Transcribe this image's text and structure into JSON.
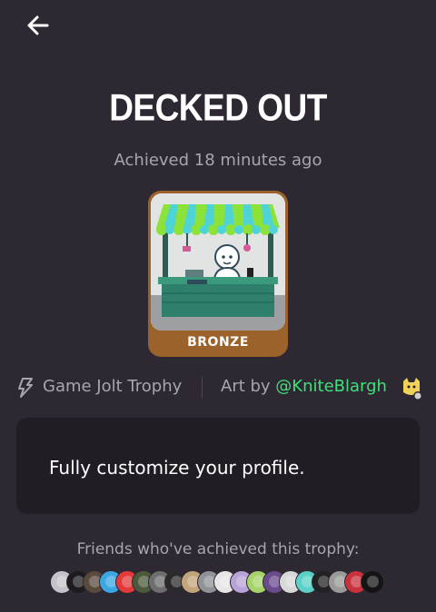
{
  "header": {
    "back_icon": "arrow-left-icon"
  },
  "trophy": {
    "title": "DECKED OUT",
    "achieved": "Achieved 18 minutes ago",
    "tier": "BRONZE",
    "tier_color": "#9b622c",
    "source": "Game Jolt Trophy",
    "source_icon": "lightning-icon",
    "art_by_prefix": "Art by ",
    "artist": "@KniteBlargh",
    "artist_color": "#3ee07a",
    "description": "Fully customize your profile."
  },
  "friends": {
    "label": "Friends who've achieved this trophy:",
    "avatars": [
      {
        "name": "friend-1",
        "color": "#c7c2c9"
      },
      {
        "name": "friend-2",
        "color": "#1d1b1e"
      },
      {
        "name": "friend-3",
        "color": "#5a4a3c"
      },
      {
        "name": "friend-4",
        "color": "#3aa6e2"
      },
      {
        "name": "friend-5",
        "color": "#e23a3a"
      },
      {
        "name": "friend-6",
        "color": "#4a5a3a"
      },
      {
        "name": "friend-7",
        "color": "#6e6e6e"
      },
      {
        "name": "friend-8",
        "color": "#2a2a2a"
      },
      {
        "name": "friend-9",
        "color": "#c2a57a"
      },
      {
        "name": "friend-10",
        "color": "#8f9296"
      },
      {
        "name": "friend-11",
        "color": "#e8e6e6"
      },
      {
        "name": "friend-12",
        "color": "#b8a2d6"
      },
      {
        "name": "friend-13",
        "color": "#a6d46a"
      },
      {
        "name": "friend-14",
        "color": "#6a4b8c"
      },
      {
        "name": "friend-15",
        "color": "#d8d8d8"
      },
      {
        "name": "friend-16",
        "color": "#5ad0c6"
      },
      {
        "name": "friend-17",
        "color": "#222222"
      },
      {
        "name": "friend-18",
        "color": "#9a9a9a"
      },
      {
        "name": "friend-19",
        "color": "#c8323c"
      },
      {
        "name": "friend-20",
        "color": "#141414"
      }
    ]
  }
}
